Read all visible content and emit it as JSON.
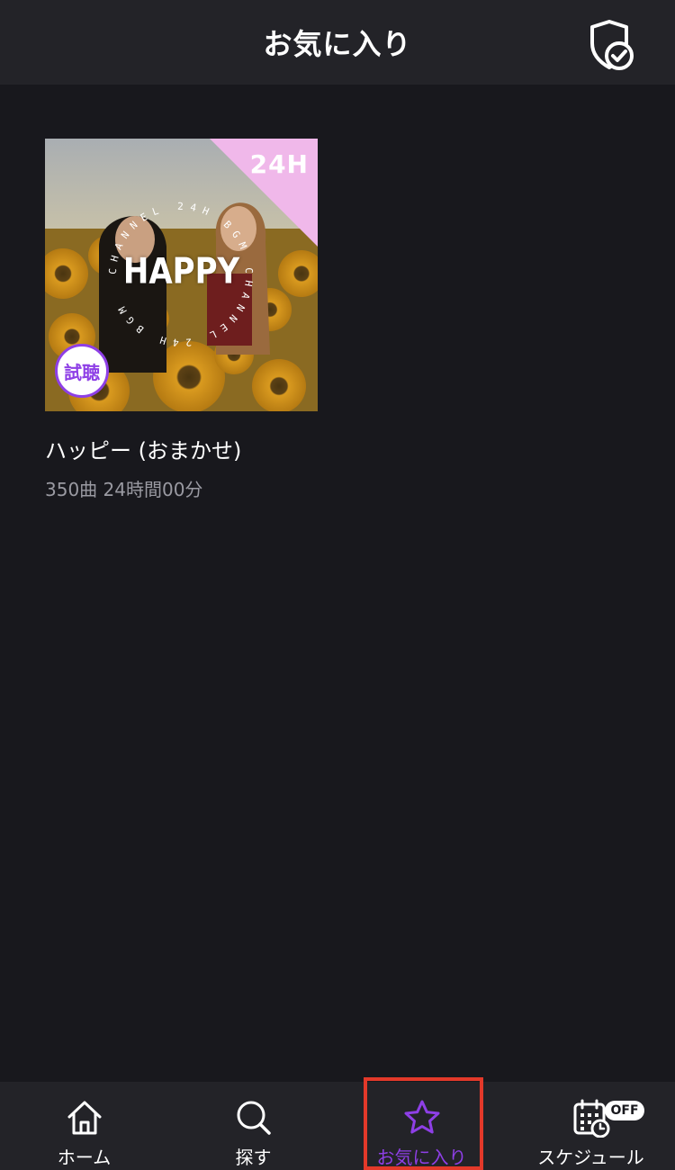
{
  "header": {
    "title": "お気に入り",
    "privacy_icon": "shield-check-icon"
  },
  "favorites": [
    {
      "title": "ハッピー (おまかせ)",
      "meta": "350曲 24時間00分",
      "art_text": "HAPPY",
      "art_ring_text": "CHANNEL 24H BGM CHANNEL 24H BGM",
      "corner_badge": "24H",
      "trial_badge": "試聴"
    }
  ],
  "tabs": [
    {
      "label": "ホーム",
      "icon": "home-icon"
    },
    {
      "label": "探す",
      "icon": "search-icon"
    },
    {
      "label": "お気に入り",
      "icon": "star-icon",
      "active": true
    },
    {
      "label": "スケジュール",
      "icon": "calendar-clock-icon",
      "badge": "OFF"
    }
  ],
  "colors": {
    "background": "#18181d",
    "bar": "#232328",
    "accent": "#8e3fe6",
    "corner": "#f0b8ea",
    "highlight_box": "#e3392a"
  }
}
